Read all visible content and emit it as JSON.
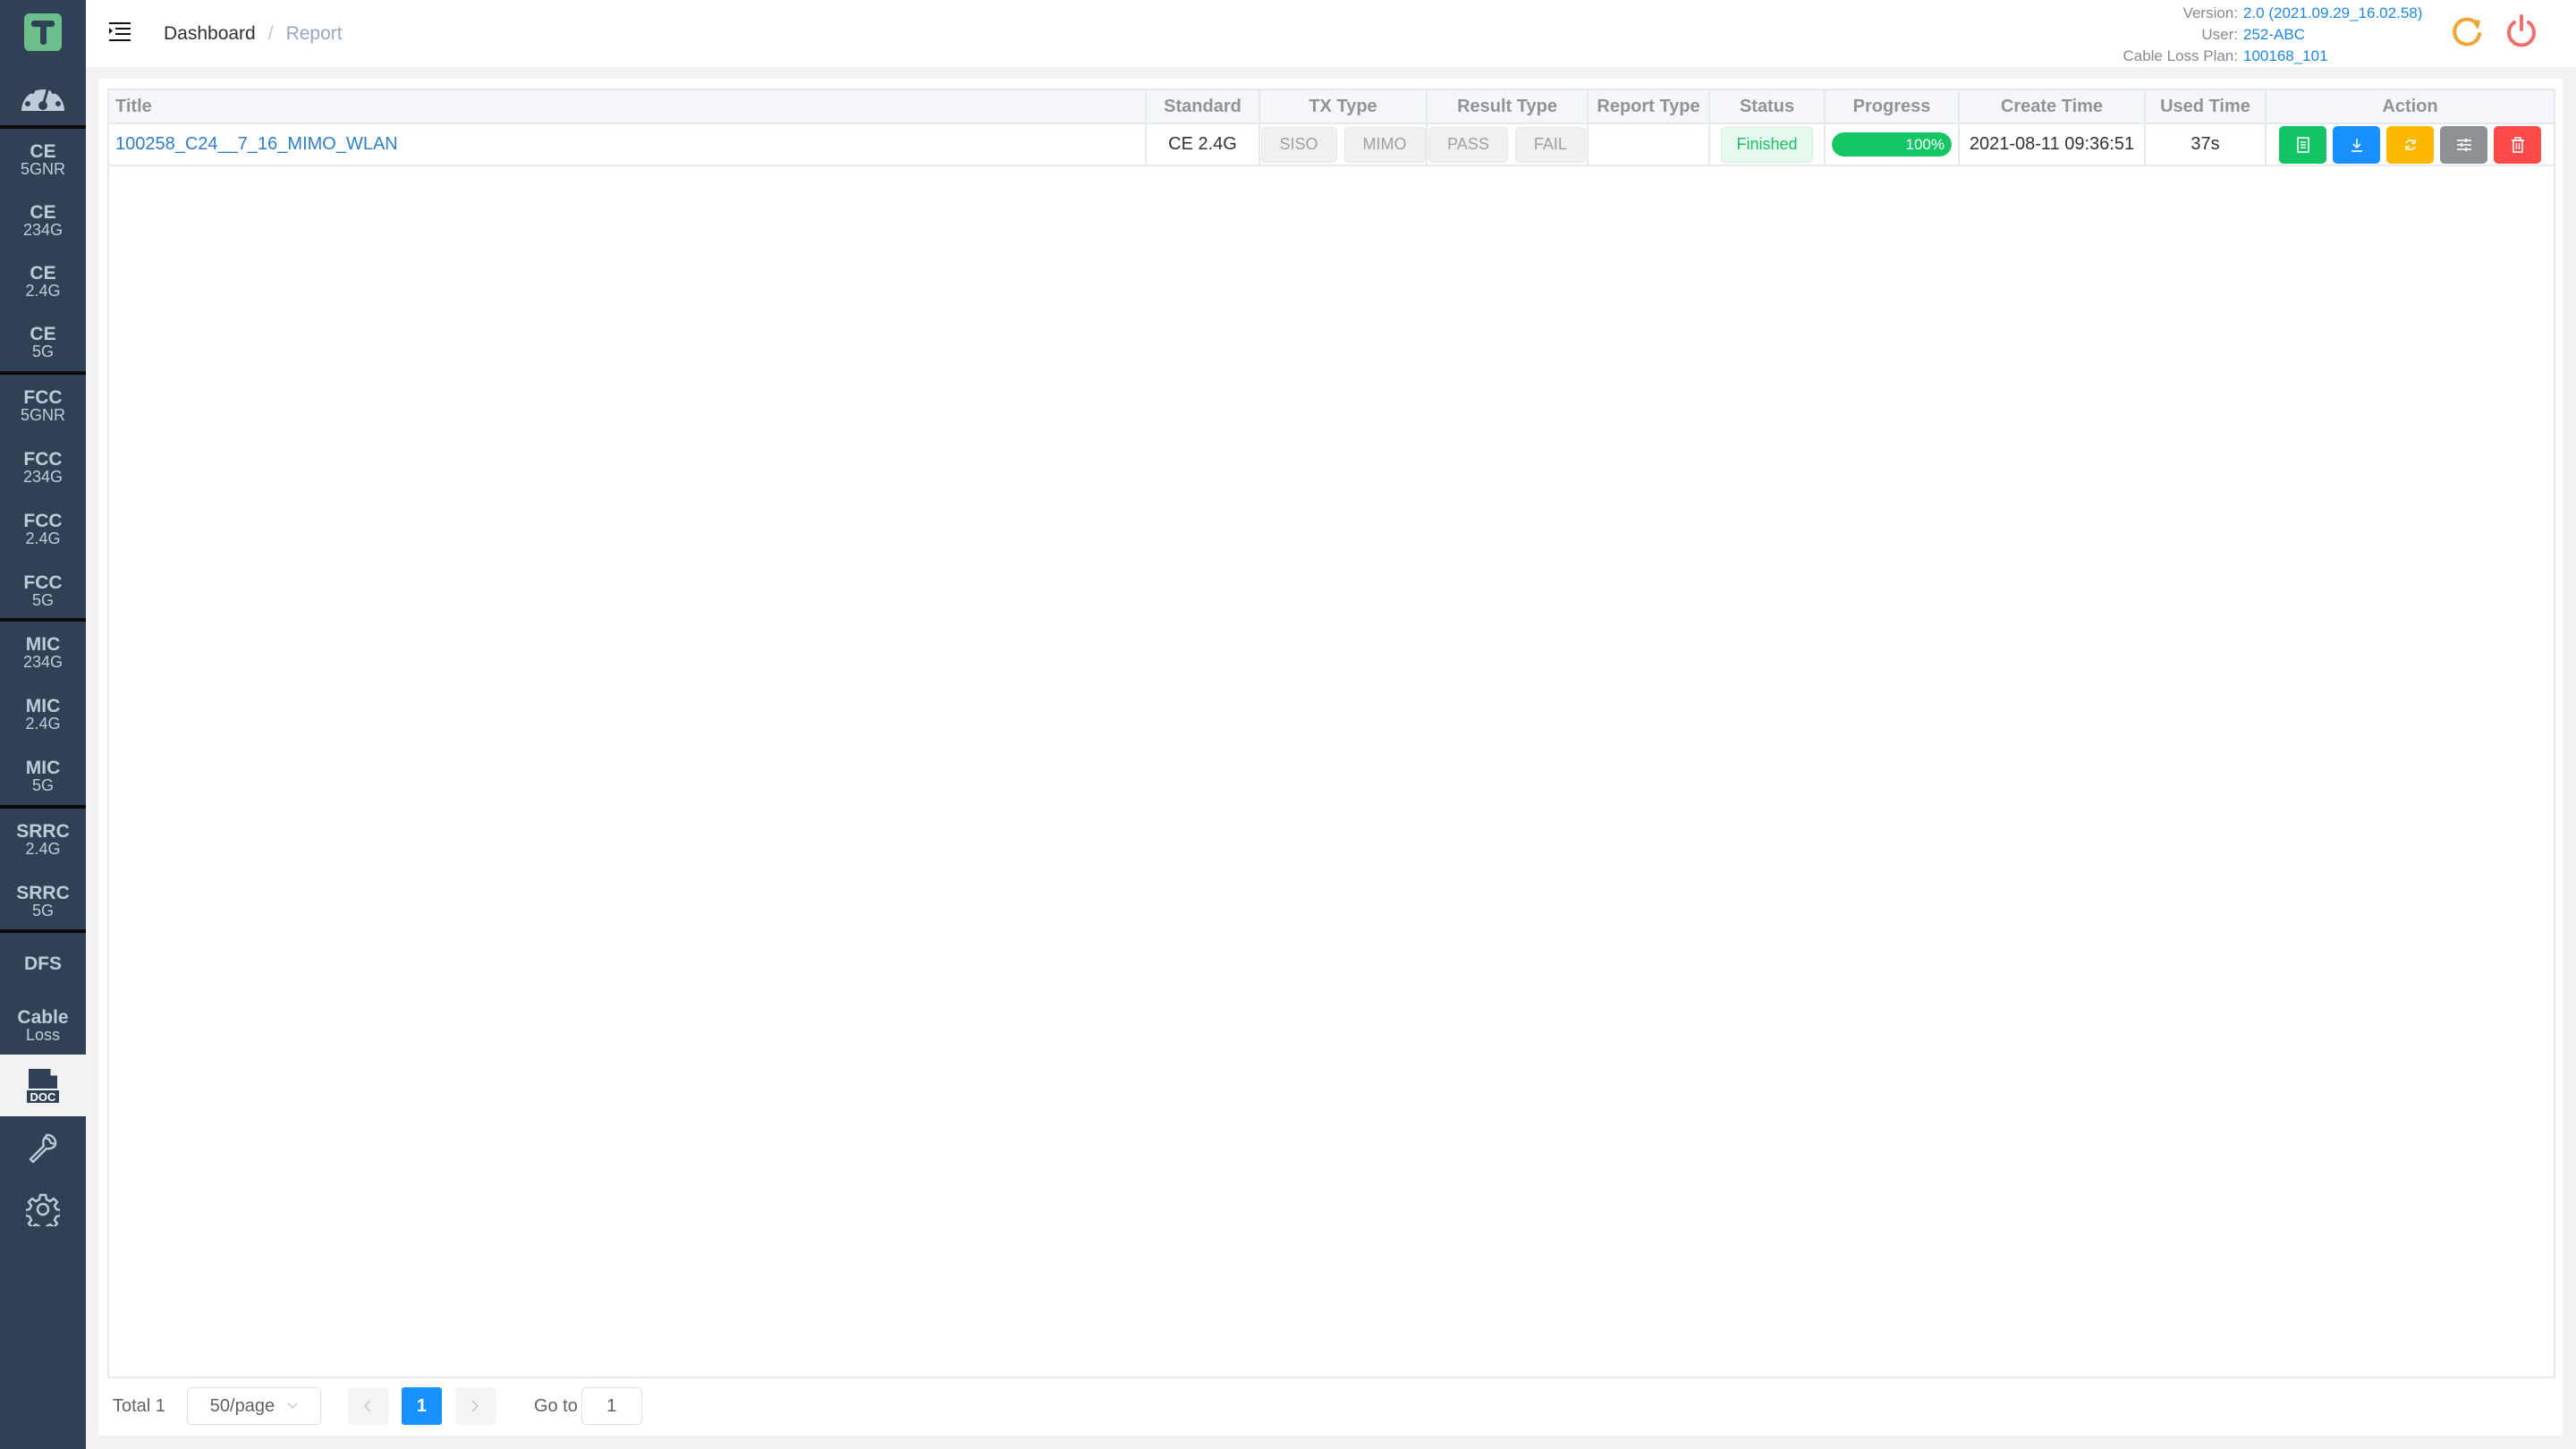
{
  "app": {
    "logo_letter": "T"
  },
  "sidebar": {
    "dashboard_icon": "dashboard-gauge-icon",
    "items": [
      {
        "line1": "CE",
        "line2": "5GNR"
      },
      {
        "line1": "CE",
        "line2": "234G"
      },
      {
        "line1": "CE",
        "line2": "2.4G"
      },
      {
        "line1": "CE",
        "line2": "5G"
      },
      {
        "line1": "FCC",
        "line2": "5GNR"
      },
      {
        "line1": "FCC",
        "line2": "234G"
      },
      {
        "line1": "FCC",
        "line2": "2.4G"
      },
      {
        "line1": "FCC",
        "line2": "5G"
      },
      {
        "line1": "MIC",
        "line2": "234G"
      },
      {
        "line1": "MIC",
        "line2": "2.4G"
      },
      {
        "line1": "MIC",
        "line2": "5G"
      },
      {
        "line1": "SRRC",
        "line2": "2.4G"
      },
      {
        "line1": "SRRC",
        "line2": "5G"
      },
      {
        "line1": "DFS",
        "line2": ""
      },
      {
        "line1": "Cable",
        "line2": "Loss"
      }
    ],
    "doc_label": "DOC",
    "active": "report"
  },
  "header": {
    "breadcrumb": {
      "home": "Dashboard",
      "separator": "/",
      "current": "Report"
    },
    "info": {
      "version_label": "Version:",
      "version_value": "2.0 (2021.09.29_16.02.58)",
      "user_label": "User:",
      "user_value": "252-ABC",
      "plan_label": "Cable Loss Plan:",
      "plan_value": "100168_101"
    },
    "refresh_color": "#f0a535",
    "power_color": "#f56c6c"
  },
  "table": {
    "columns": [
      "Title",
      "Standard",
      "TX Type",
      "Result Type",
      "Report Type",
      "Status",
      "Progress",
      "Create Time",
      "Used Time",
      "Action"
    ],
    "rows": [
      {
        "title": "100258_C24__7_16_MIMO_WLAN",
        "standard": "CE 2.4G",
        "tx_types": [
          "SISO",
          "MIMO"
        ],
        "result_types": [
          "PASS",
          "FAIL"
        ],
        "report_type": "",
        "status": "Finished",
        "progress": 100,
        "progress_label": "100%",
        "create_time": "2021-08-11 09:36:51",
        "used_time": "37s",
        "actions": [
          {
            "name": "view-report",
            "icon": "document-icon",
            "color": "#13c466"
          },
          {
            "name": "download",
            "icon": "download-icon",
            "color": "#1890ff"
          },
          {
            "name": "regenerate",
            "icon": "refresh-icon",
            "color": "#ffb800"
          },
          {
            "name": "settings",
            "icon": "sliders-icon",
            "color": "#8e9196"
          },
          {
            "name": "delete",
            "icon": "trash-icon",
            "color": "#ff4a4a"
          }
        ]
      }
    ]
  },
  "pagination": {
    "total_label": "Total 1",
    "page_size": "50/page",
    "current_page": "1",
    "goto_label": "Go to",
    "goto_value": "1"
  }
}
